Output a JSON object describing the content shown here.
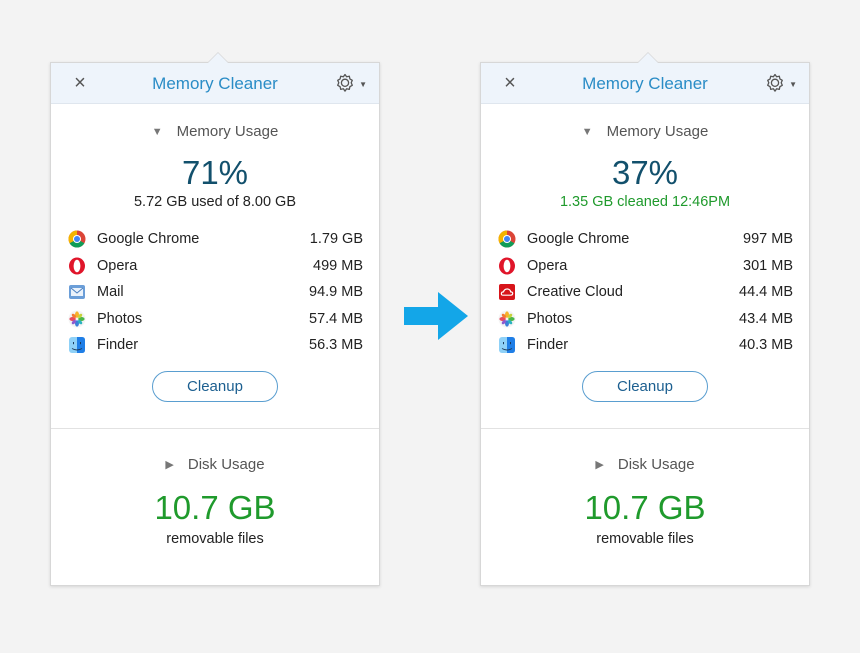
{
  "colors": {
    "title_blue": "#2a8cc6",
    "percent_navy": "#12506c",
    "cleaned_green": "#1f9a2c",
    "arrow_blue": "#13a6e8"
  },
  "panels": [
    {
      "title": "Memory Cleaner",
      "close_icon": "×",
      "memory_label": "Memory Usage",
      "percent": "71%",
      "subline": "5.72 GB used of 8.00 GB",
      "apps": [
        {
          "name": "Google Chrome",
          "size": "1.79 GB",
          "icon": "chrome-icon"
        },
        {
          "name": "Opera",
          "size": "499 MB",
          "icon": "opera-icon"
        },
        {
          "name": "Mail",
          "size": "94.9 MB",
          "icon": "mail-icon"
        },
        {
          "name": "Photos",
          "size": "57.4 MB",
          "icon": "photos-icon"
        },
        {
          "name": "Finder",
          "size": "56.3 MB",
          "icon": "finder-icon"
        }
      ],
      "cleanup_label": "Cleanup",
      "disk_label": "Disk Usage",
      "disk_value": "10.7 GB",
      "disk_sub": "removable files"
    },
    {
      "title": "Memory Cleaner",
      "close_icon": "×",
      "memory_label": "Memory Usage",
      "percent": "37%",
      "subline": "1.35 GB cleaned 12:46PM",
      "apps": [
        {
          "name": "Google Chrome",
          "size": "997 MB",
          "icon": "chrome-icon"
        },
        {
          "name": "Opera",
          "size": "301 MB",
          "icon": "opera-icon"
        },
        {
          "name": "Creative Cloud",
          "size": "44.4 MB",
          "icon": "creative-cloud-icon"
        },
        {
          "name": "Photos",
          "size": "43.4 MB",
          "icon": "photos-icon"
        },
        {
          "name": "Finder",
          "size": "40.3 MB",
          "icon": "finder-icon"
        }
      ],
      "cleanup_label": "Cleanup",
      "disk_label": "Disk Usage",
      "disk_value": "10.7 GB",
      "disk_sub": "removable files"
    }
  ]
}
